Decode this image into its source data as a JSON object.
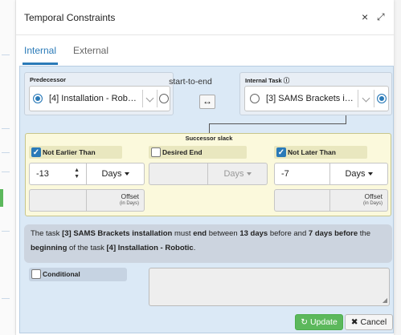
{
  "dialog": {
    "title": "Temporal Constraints",
    "close_icon": "×",
    "expand_icon": "⤢"
  },
  "tabs": [
    {
      "label": "Internal",
      "active": true
    },
    {
      "label": "External",
      "active": false
    }
  ],
  "predecessor": {
    "label": "Predecessor",
    "task": "[4] Installation - Rob…",
    "start_selected": true,
    "end_selected": false
  },
  "relation": {
    "label": "start-to-end",
    "swap_icon": "↔"
  },
  "internal_task": {
    "label": "Internal Task ⓘ",
    "task": "[3] SAMS Brackets i…",
    "start_selected": false,
    "end_selected": true
  },
  "successor_slack": {
    "title": "Successor slack",
    "not_earlier_than": {
      "label": "Not Earlier Than",
      "checked": true,
      "value": "-13",
      "unit": "Days",
      "offset_label": "Offset",
      "offset_sub": "(in Days)"
    },
    "desired_end": {
      "label": "Desired End",
      "checked": false,
      "unit": "Days"
    },
    "not_later_than": {
      "label": "Not Later Than",
      "checked": true,
      "value": "-7",
      "unit": "Days",
      "offset_label": "Offset",
      "offset_sub": "(in Days)"
    }
  },
  "summary": {
    "t1": "The task ",
    "t2": "[3] SAMS Brackets installation",
    "t3": " must ",
    "t4": "end",
    "t5": " between ",
    "t6": "13 days",
    "t7": " before and ",
    "t8": "7 days before",
    "t9": " the ",
    "t10": "beginning",
    "t11": " of the task ",
    "t12": "[4] Installation - Robotic",
    "t13": "."
  },
  "conditional": {
    "label": "Conditional",
    "checked": false,
    "text": ""
  },
  "buttons": {
    "update": "Update",
    "update_icon": "↻",
    "cancel": "Cancel",
    "cancel_icon": "✖"
  },
  "colors": {
    "accent": "#2a7ab8",
    "slack_bg": "#fbf9dc",
    "content_bg": "#dbe9f6",
    "update_green": "#5cb85c"
  }
}
